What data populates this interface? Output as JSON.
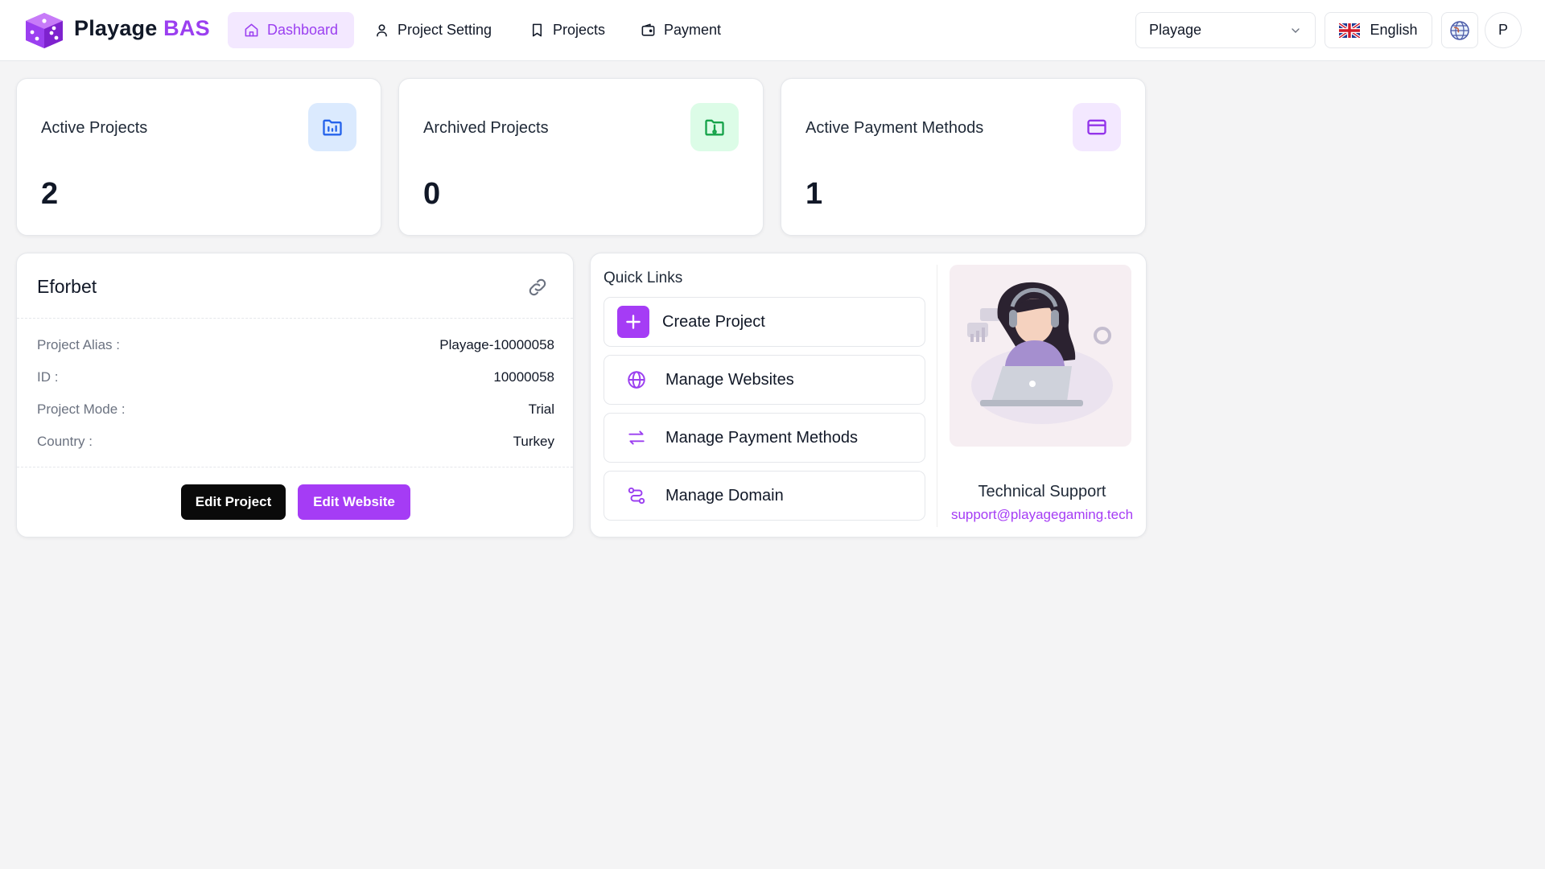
{
  "brand": {
    "name": "Playage",
    "accent": "BAS",
    "accent_color": "#9b3ff0"
  },
  "nav": [
    {
      "label": "Dashboard",
      "icon": "home-icon",
      "active": true
    },
    {
      "label": "Project Setting",
      "icon": "user-icon"
    },
    {
      "label": "Projects",
      "icon": "bookmark-icon"
    },
    {
      "label": "Payment",
      "icon": "wallet-icon"
    }
  ],
  "header": {
    "workspace_value": "Playage",
    "language": "English",
    "avatar_initial": "P"
  },
  "stats": [
    {
      "label": "Active Projects",
      "value": "2",
      "icon": "folder-chart-icon",
      "color": "#2563eb"
    },
    {
      "label": "Archived Projects",
      "value": "0",
      "icon": "folder-archive-icon",
      "color": "#16a34a"
    },
    {
      "label": "Active Payment Methods",
      "value": "1",
      "icon": "credit-card-icon",
      "color": "#9333ea"
    }
  ],
  "project": {
    "name": "Eforbet",
    "rows": [
      {
        "key": "Project Alias :",
        "value": "Playage-10000058"
      },
      {
        "key": "ID :",
        "value": "10000058"
      },
      {
        "key": "Project Mode :",
        "value": "Trial"
      },
      {
        "key": "Country :",
        "value": "Turkey"
      }
    ],
    "edit_project_label": "Edit Project",
    "edit_website_label": "Edit Website"
  },
  "quick_links": {
    "title": "Quick Links",
    "items": [
      {
        "label": "Create Project",
        "icon": "plus-icon"
      },
      {
        "label": "Manage Websites",
        "icon": "globe-icon"
      },
      {
        "label": "Manage Payment Methods",
        "icon": "swap-arrows-icon"
      },
      {
        "label": "Manage Domain",
        "icon": "route-icon"
      }
    ]
  },
  "support": {
    "title": "Technical Support",
    "email": "support@playagegaming.tech"
  }
}
